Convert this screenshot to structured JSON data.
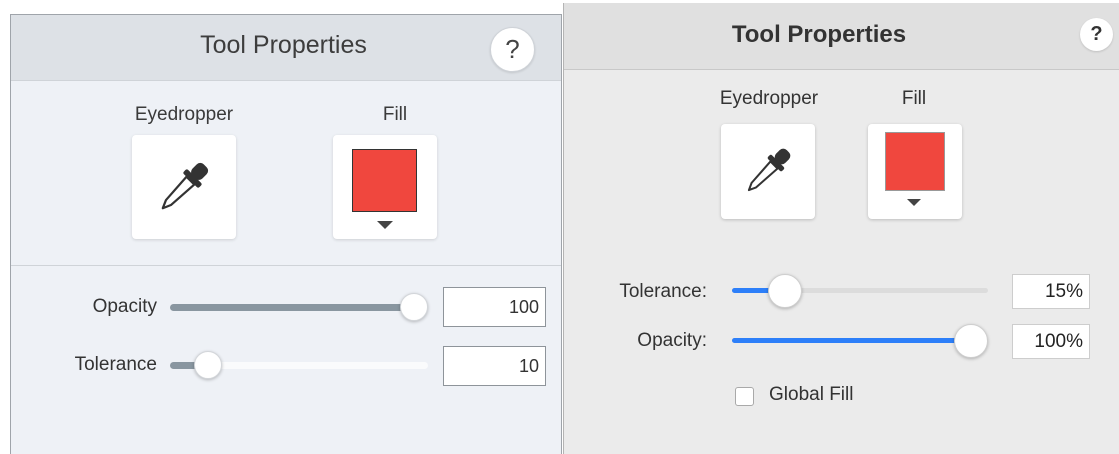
{
  "left_panel": {
    "title": "Tool Properties",
    "help_label": "?",
    "eyedropper_label": "Eyedropper",
    "fill_label": "Fill",
    "fill_color": "#f0473e",
    "eyedropper_icon": "eyedropper-icon",
    "opacity": {
      "label": "Opacity",
      "value": "100",
      "level": 1.0
    },
    "tolerance": {
      "label": "Tolerance",
      "value": "10",
      "level": 0.1
    },
    "slider_fill_color": "#8996a0"
  },
  "right_panel": {
    "title": "Tool Properties",
    "help_label": "?",
    "eyedropper_label": "Eyedropper",
    "fill_label": "Fill",
    "fill_color": "#f0473e",
    "eyedropper_icon": "eyedropper-icon",
    "tolerance": {
      "label": "Tolerance:",
      "value": "15%",
      "level": 0.15
    },
    "opacity": {
      "label": "Opacity:",
      "value": "100%",
      "level": 1.0
    },
    "global_fill": {
      "label": "Global Fill",
      "checked": false
    },
    "slider_fill_color": "#2d7ff9"
  }
}
